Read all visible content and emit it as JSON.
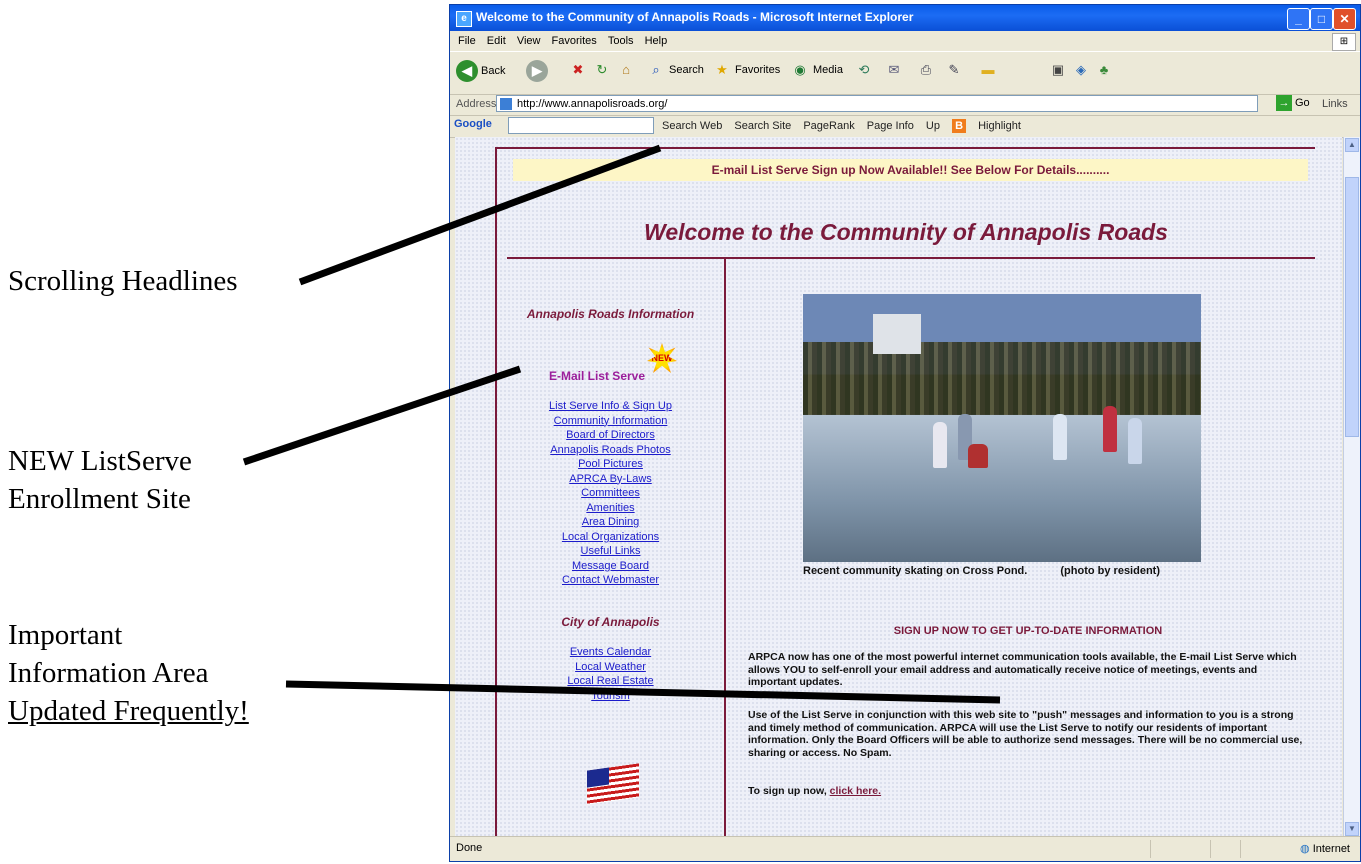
{
  "annotations": {
    "scrolling_headlines": "Scrolling Headlines",
    "listserve_line1": "NEW ListServe",
    "listserve_line2": "Enrollment Site",
    "important_line1": "Important",
    "important_line2": "Information  Area",
    "important_line3": "Updated Frequently!"
  },
  "browser": {
    "title": "Welcome to the Community of Annapolis Roads - Microsoft Internet Explorer",
    "menu": [
      "File",
      "Edit",
      "View",
      "Favorites",
      "Tools",
      "Help"
    ],
    "toolbar": {
      "back": "Back",
      "search": "Search",
      "favorites": "Favorites",
      "media": "Media"
    },
    "address_label": "Address",
    "address_value": "http://www.annapolisroads.org/",
    "go_label": "Go",
    "links_label": "Links",
    "google": {
      "logo": "Google",
      "items": [
        "Search Web",
        "Search Site",
        "PageRank",
        "Page Info",
        "Up",
        "Highlight"
      ]
    },
    "status_text": "Done",
    "zone_text": "Internet"
  },
  "page": {
    "banner": "E-mail List Serve Sign up Now Available!!  See Below For Details..........",
    "welcome_title": "Welcome to the Community of Annapolis Roads",
    "nav_heading_info": "Annapolis Roads Information",
    "nav_heading_listserve": "E-Mail List Serve",
    "new_badge": "NEW",
    "nav_links": [
      "List Serve Info & Sign Up",
      "Community Information",
      "Board of Directors",
      "Annapolis Roads Photos",
      "Pool Pictures",
      "APRCA By-Laws",
      "Committees",
      "Amenities",
      "Area Dining",
      "Local Organizations",
      "Useful Links",
      "Message Board",
      "Contact Webmaster"
    ],
    "nav_heading_city": "City of Annapolis",
    "city_links": [
      "Events Calendar",
      "Local Weather",
      "Local Real Estate",
      "Tourism"
    ],
    "photo_caption": "Recent community skating on Cross Pond.",
    "photo_credit": "(photo by resident)",
    "signup_heading": "SIGN UP NOW TO GET UP-TO-DATE INFORMATION",
    "paragraph_1": "ARPCA now has one of the most powerful internet communication tools available, the E-mail List Serve which allows YOU to self-enroll your email address and automatically receive notice of meetings, events and important updates.",
    "paragraph_2": "Use of the List Serve in conjunction with this web site to \"push\" messages and information to you is a strong and timely method of communication. ARPCA will use the List Serve to notify our residents of important information. Only the Board Officers will be able to authorize send messages. There will be no commercial use, sharing or access. No Spam.",
    "signup_prefix": "To sign up now,",
    "signup_link": "click here."
  },
  "colors": {
    "accent": "#7a1a3b",
    "link": "#1c1ccb",
    "banner_bg": "#fdf6c6",
    "titlebar": "#0a5ce8"
  }
}
